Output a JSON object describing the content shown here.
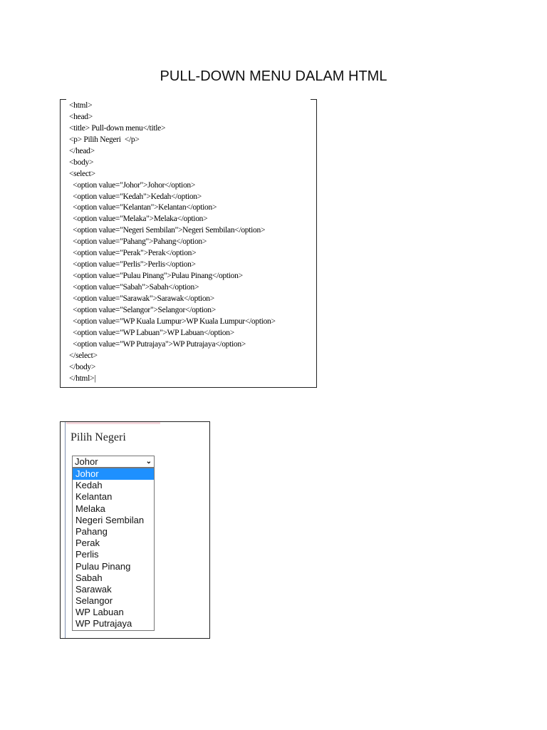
{
  "title": "PULL-DOWN MENU DALAM HTML",
  "code_lines": [
    "<html>",
    "<head>",
    "<title> Pull-down menu</title>",
    "<p> Pilih Negeri  </p>",
    "</head>",
    "<body>",
    "<select>",
    "  <option value=\"Johor\">Johor</option>",
    "  <option value=\"Kedah\">Kedah</option>",
    "  <option value=\"Kelantan\">Kelantan</option>",
    "  <option value=\"Melaka\">Melaka</option>",
    "  <option value=\"Negeri Sembilan\">Negeri Sembilan</option>",
    "  <option value=\"Pahang\">Pahang</option>",
    "  <option value=\"Perak\">Perak</option>",
    "  <option value=\"Perlis\">Perlis</option>",
    "  <option value=\"Pulau Pinang\">Pulau Pinang</option>",
    "  <option value=\"Sabah\">Sabah</option>",
    "  <option value=\"Sarawak\">Sarawak</option>",
    "  <option value=\"Selangor\">Selangor</option>",
    "  <option value=\"WP Kuala Lumpur>WP Kuala Lumpur</option>",
    "  <option value=\"WP Labuan\">WP Labuan</option>",
    "  <option value=\"WP Putrajaya\">WP Putrajaya</option>",
    "</select>",
    "</body>",
    "</html>|"
  ],
  "demo": {
    "label": "Pilih Negeri",
    "selected": "Johor",
    "options": [
      "Johor",
      "Kedah",
      "Kelantan",
      "Melaka",
      "Negeri Sembilan",
      "Pahang",
      "Perak",
      "Perlis",
      "Pulau Pinang",
      "Sabah",
      "Sarawak",
      "Selangor",
      "WP Labuan",
      "WP Putrajaya"
    ],
    "highlight_color": "#1e90ff"
  }
}
